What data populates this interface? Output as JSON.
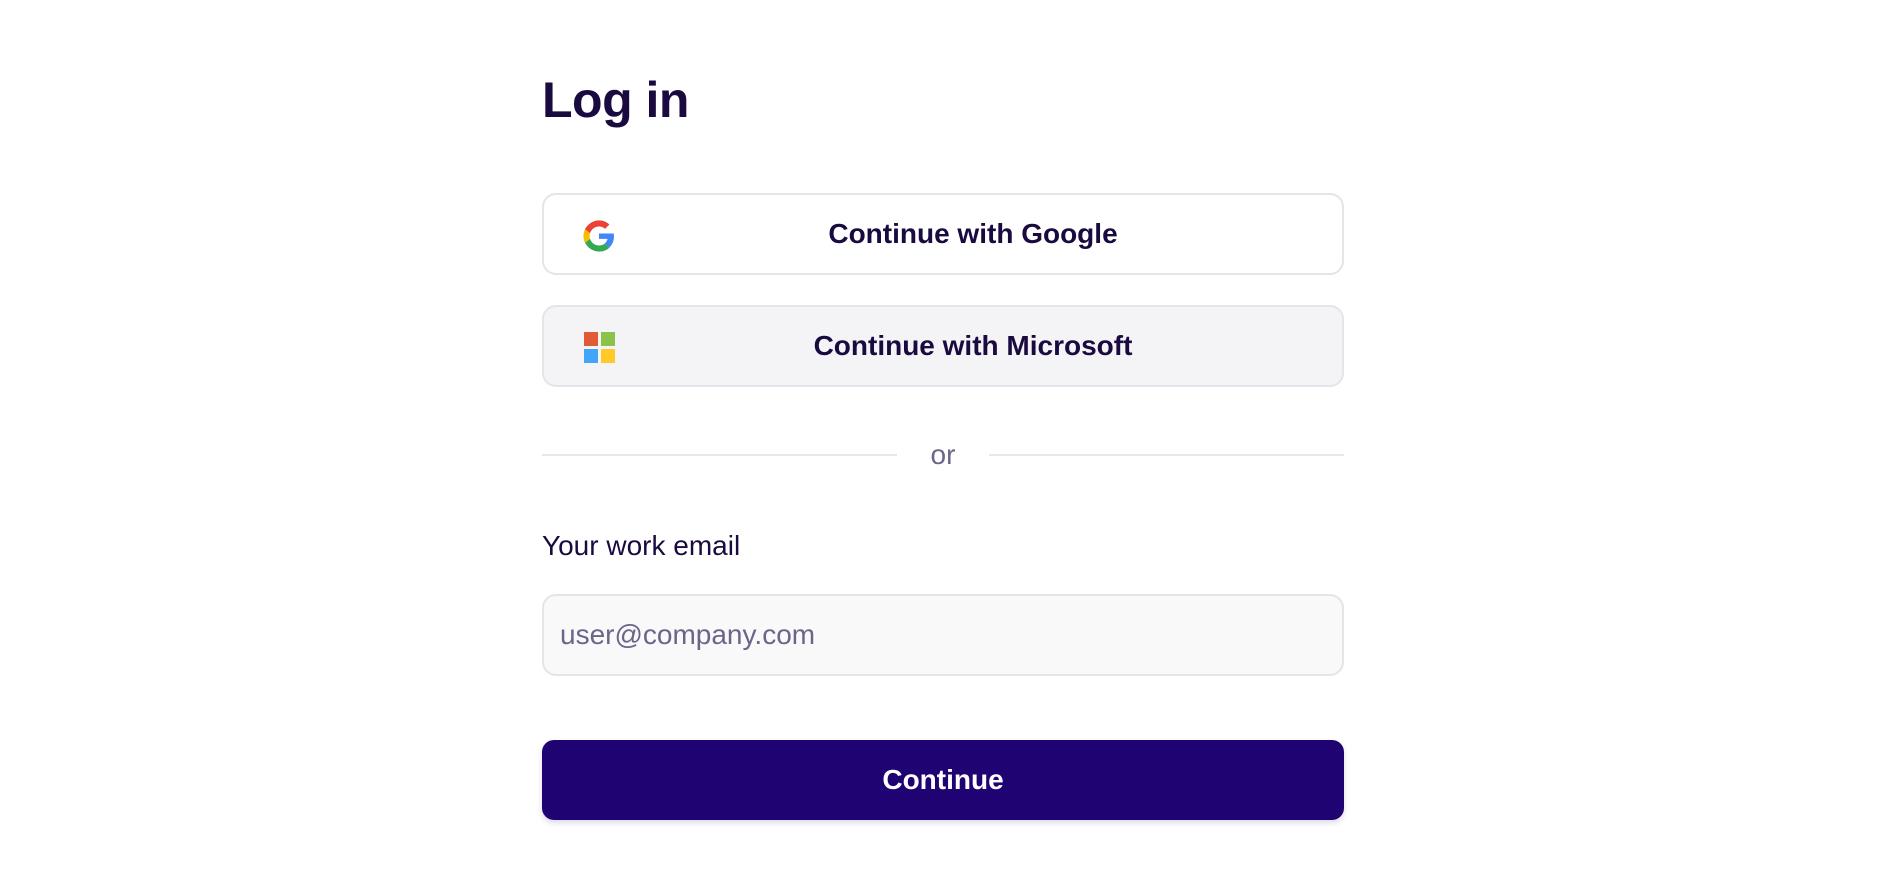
{
  "page": {
    "title": "Log in"
  },
  "sso": {
    "google": {
      "label": "Continue with Google",
      "icon": "google-icon"
    },
    "microsoft": {
      "label": "Continue with Microsoft",
      "icon": "microsoft-icon"
    }
  },
  "divider": {
    "text": "or"
  },
  "email": {
    "label": "Your work email",
    "value": "",
    "placeholder": "user@company.com"
  },
  "submit": {
    "label": "Continue"
  },
  "colors": {
    "primary": "#200372",
    "text": "#1a0a3f",
    "muted": "#6b6589",
    "border": "#e4e4ea",
    "microsoft_red": "#e05a35",
    "microsoft_green": "#8bc34a",
    "microsoft_blue": "#42a5f5",
    "microsoft_yellow": "#ffca28"
  }
}
